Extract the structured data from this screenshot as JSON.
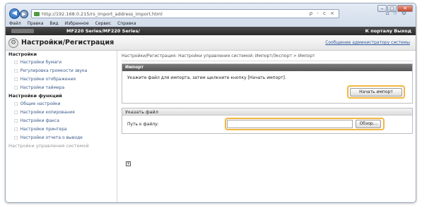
{
  "browser": {
    "url": "http://192.168.0.215/rs_import_address_import.html",
    "addr_controls": "ρ - c ×",
    "window_buttons": {
      "minimize": "–",
      "maximize": "□",
      "close": "✕"
    },
    "menu": [
      "Файл",
      "Правка",
      "Вид",
      "Избранное",
      "Сервис",
      "Справка"
    ]
  },
  "header": {
    "model": "MF220 Series/MF220 Series/",
    "portal_link": "К порталу  Выход",
    "page_title": "Настройки/Регистрация",
    "mail_link": "Сообщение администратору системы"
  },
  "sidebar": {
    "section1": "Настройки",
    "items1": [
      "Настройки бумаги",
      "Регулировка громкости звука",
      "Настройки отображения",
      "Настройки таймера"
    ],
    "section2": "Настройки функций",
    "items2": [
      "Общие настройки",
      "Настройки копирования",
      "Настройки факса",
      "Настройки принтера",
      "Настройки отчета о выводе"
    ],
    "section3": "Настройки управления системой"
  },
  "main": {
    "breadcrumb": "Настройки/Регистрация: Настройки управления системой: Импорт/Экспорт > Импорт",
    "import_header": "Импорт",
    "import_message": "Укажите файл для импорта, затем щелкните кнопку [Начать импорт].",
    "start_button": "Начать импорт",
    "file_header": "Указать файл",
    "path_label": "Путь к файлу:",
    "browse_button": "Обзор...",
    "expand_icon": "+"
  }
}
